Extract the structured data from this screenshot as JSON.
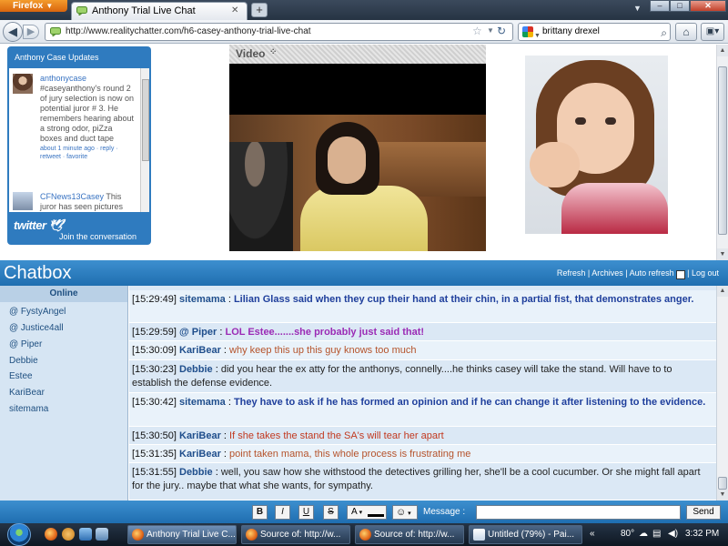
{
  "browser": {
    "menu_label": "Firefox",
    "tab_title": "Anthony Trial Live Chat",
    "new_tab_symbol": "+",
    "url": "http://www.realitychatter.com/h6-casey-anthony-trial-live-chat",
    "search_text": "brittany drexel",
    "window_controls": [
      "–",
      "□",
      "✕"
    ]
  },
  "twitter_widget": {
    "header": "Anthony Case Updates",
    "tweets": [
      {
        "user": "anthonycase",
        "text": "#caseyanthony's round 2 of jury selection is now on potential juror # 3. He remembers hearing about a strong odor, piZza boxes and duct tape",
        "meta": "about 1 minute ago · reply · retweet · favorite"
      },
      {
        "user": "CFNews13Casey",
        "text": "This juror has seen pictures",
        "meta": ""
      }
    ],
    "logo": "twitter",
    "join_text": "Join the conversation"
  },
  "video": {
    "title": "Video"
  },
  "chat": {
    "title": "Chatbox",
    "links": {
      "refresh": "Refresh",
      "archives": "Archives",
      "auto_refresh": "Auto refresh",
      "auto_refresh_checked": true,
      "logout": "Log out"
    },
    "online_label": "Online",
    "users": [
      "@ FystyAngel",
      "@ Justice4all",
      "@ Piper",
      "Debbie",
      "Estee",
      "KariBear",
      "sitemama"
    ],
    "messages": [
      {
        "time": "[15:29:49]",
        "name": "sitemama",
        "text": "Lilian Glass said when they cup their hand at their chin, in a partial fist, that demonstrates anger.",
        "color": "#1f3f9c",
        "bold": true
      },
      {
        "time": "[15:29:59]",
        "name": "@ Piper",
        "text": "LOL Estee.......she probably just said that!",
        "color": "#9b2bb5",
        "bold": true
      },
      {
        "time": "[15:30:09]",
        "name": "KariBear",
        "text": "why keep this up this guy knows too much",
        "color": "#b5532b",
        "bold": false
      },
      {
        "time": "[15:30:23]",
        "name": "Debbie",
        "text": "did you hear the ex atty for the anthonys, connelly....he thinks casey will take the stand. Will have to to establish the defense evidence.",
        "color": "#222222",
        "bold": false
      },
      {
        "time": "[15:30:42]",
        "name": "sitemama",
        "text": "They have to ask if he has formed an opinion and if he can change it after listening to the evidence.",
        "color": "#1f3f9c",
        "bold": true
      },
      {
        "time": "[15:30:50]",
        "name": "KariBear",
        "text": "If she takes the stand the SA's will tear her apart",
        "color": "#c2391f",
        "bold": false
      },
      {
        "time": "[15:31:35]",
        "name": "KariBear",
        "text": "point taken mama, this whole process is frustrating me",
        "color": "#b5532b",
        "bold": false
      },
      {
        "time": "[15:31:55]",
        "name": "Debbie",
        "text": "well, you saw how she withstood the detectives grilling her, she'll be a cool cucumber. Or she might fall apart for the jury.. maybe that what she wants, for sympathy.",
        "color": "#222222",
        "bold": false
      }
    ],
    "toolbar": {
      "bold": "B",
      "italic": "I",
      "underline": "U",
      "strike": "S",
      "color_letter": "A",
      "smiley": "☺",
      "message_label": "Message :",
      "message_value": "",
      "send": "Send"
    }
  },
  "taskbar": {
    "buttons": [
      {
        "label": "Anthony Trial Live C...",
        "active": true
      },
      {
        "label": "Source of: http://w...",
        "active": false
      },
      {
        "label": "Source of: http://w...",
        "active": false
      },
      {
        "label": "Untitled (79%) - Pai...",
        "active": false
      }
    ],
    "temperature": "80°",
    "clock": "3:32 PM"
  }
}
